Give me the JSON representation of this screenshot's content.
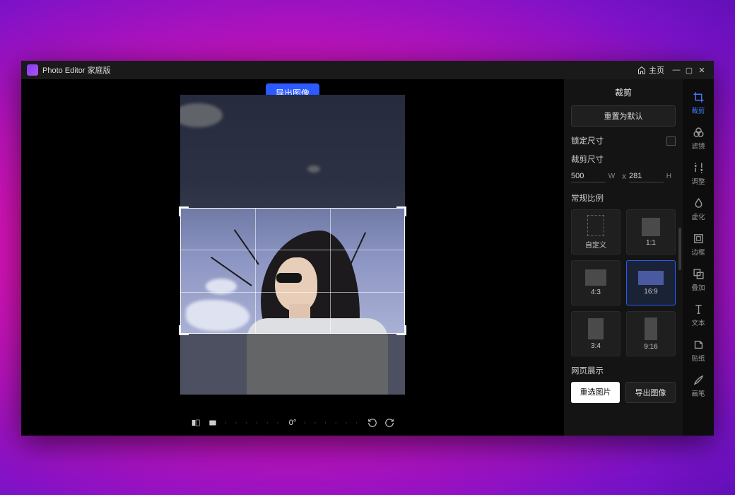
{
  "titlebar": {
    "title": "Photo Editor 家庭版",
    "home": "主页"
  },
  "canvas": {
    "export_top": "导出图像",
    "degree": "0°"
  },
  "panel": {
    "title": "裁剪",
    "reset": "重置为默认",
    "lock_size": "锁定尺寸",
    "crop_size": "裁剪尺寸",
    "width": "500",
    "w_lbl": "W",
    "x": "x",
    "height": "281",
    "h_lbl": "H",
    "ratios_lbl": "常规比例",
    "ratios": [
      {
        "label": "自定义",
        "cls": "rc-custom"
      },
      {
        "label": "1:1",
        "cls": "rc-11"
      },
      {
        "label": "4:3",
        "cls": "rc-43"
      },
      {
        "label": "16:9",
        "cls": "rc-169",
        "selected": true
      },
      {
        "label": "3:4",
        "cls": "rc-34"
      },
      {
        "label": "9:16",
        "cls": "rc-916"
      }
    ],
    "web_display": "网页展示",
    "reselect": "重选图片",
    "export": "导出图像"
  },
  "tools": [
    {
      "id": "crop",
      "label": "裁剪",
      "active": true
    },
    {
      "id": "filter",
      "label": "滤镜"
    },
    {
      "id": "adjust",
      "label": "调整"
    },
    {
      "id": "blur",
      "label": "虚化"
    },
    {
      "id": "frame",
      "label": "边框"
    },
    {
      "id": "overlay",
      "label": "叠加"
    },
    {
      "id": "text",
      "label": "文本"
    },
    {
      "id": "sticker",
      "label": "贴纸"
    },
    {
      "id": "brush",
      "label": "画笔"
    }
  ]
}
